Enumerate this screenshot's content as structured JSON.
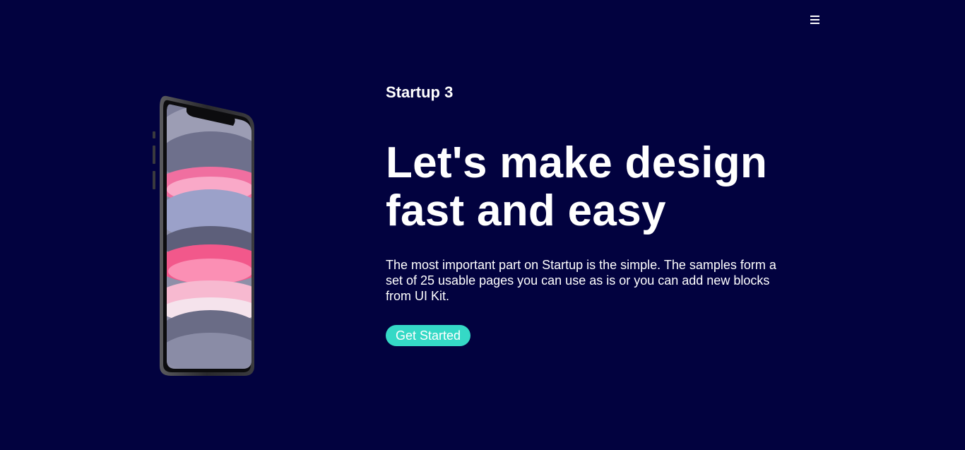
{
  "header": {
    "menu_icon": "hamburger-menu-icon"
  },
  "hero": {
    "brand": "Startup 3",
    "headline": "Let's make design fast and easy",
    "description": "The most important part on Startup is the simple. The samples form a set of 25 usable pages you can use as is or you can add new blocks from UI Kit.",
    "cta_label": "Get Started",
    "phone_image": "smartphone-mockup"
  },
  "colors": {
    "background": "#02023f",
    "text": "#ffffff",
    "accent": "#35d9c6"
  }
}
